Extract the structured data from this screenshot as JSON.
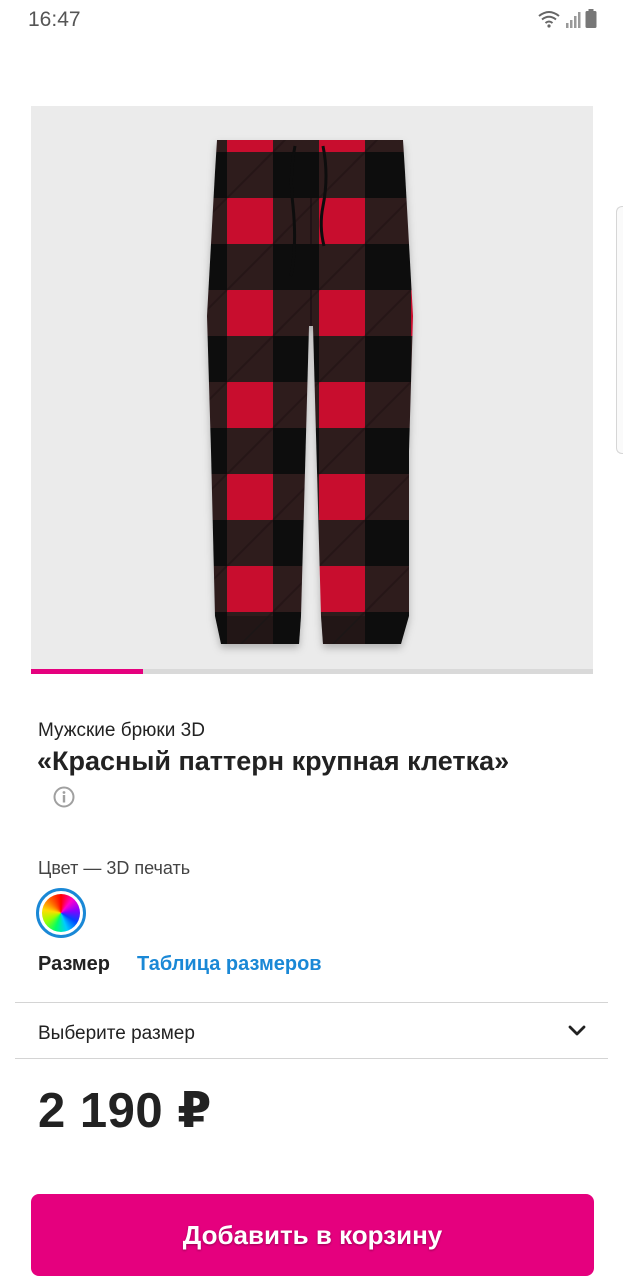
{
  "status_bar": {
    "time": "16:47",
    "icons": [
      "wifi-icon",
      "signal-icon",
      "battery-icon"
    ]
  },
  "gallery": {
    "image": "plaid-pants-image",
    "progress": 0.2
  },
  "product": {
    "subtitle": "Мужские брюки 3D",
    "title": "«Красный паттерн крупная клетка»",
    "info_icon": "info-icon"
  },
  "color": {
    "label": "Цвет — 3D печать",
    "swatch": "3D печать"
  },
  "size": {
    "label": "Размер",
    "table_link": "Таблица размеров",
    "select_placeholder": "Выберите размер"
  },
  "price": "2 190 ₽",
  "cart": {
    "button_label": "Добавить в корзину"
  },
  "colors": {
    "accent": "#e5007e",
    "link": "#1a88d6",
    "plaid_red": "#c8102e",
    "plaid_black": "#1c1c1c"
  }
}
